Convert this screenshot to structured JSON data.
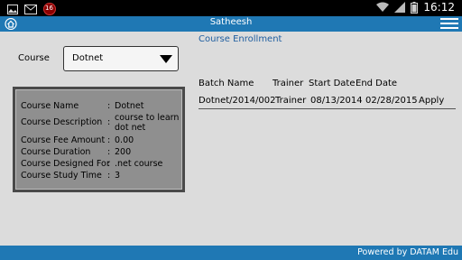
{
  "statusbar": {
    "icons": [
      "image-icon",
      "gmail-icon",
      "notification-count-icon"
    ],
    "badge": "16",
    "right_icons": [
      "wifi-icon",
      "signal-icon",
      "battery-icon"
    ],
    "time": "16:12"
  },
  "appbar": {
    "title": "Satheesh",
    "left_icon": "home-icon",
    "right_icon": "menu-icon"
  },
  "page": {
    "section_title": "Course Enrollment",
    "course_label": "Course",
    "course_selected": "Dotnet"
  },
  "course_info": {
    "rows": [
      {
        "key": "Course Name",
        "sep": ":",
        "value": "Dotnet"
      },
      {
        "key": "Course Description",
        "sep": ":",
        "value": "course to learn dot net"
      },
      {
        "key": "Course Fee Amount",
        "sep": ":",
        "value": "0.00"
      },
      {
        "key": "Course Duration",
        "sep": ":",
        "value": "200"
      },
      {
        "key": "Course Designed For",
        "sep": ":",
        "value": ".net course"
      },
      {
        "key": "Course Study Time",
        "sep": ":",
        "value": "3"
      }
    ]
  },
  "batches": {
    "headers": [
      "Batch Name",
      "Trainer",
      "Start Date",
      "End Date"
    ],
    "rows": [
      {
        "batch": "Dotnet/2014/002",
        "trainer": "Trainer",
        "start": "08/13/2014",
        "end": "02/28/2015",
        "action": "Apply"
      }
    ]
  },
  "footer": {
    "text": "Powered by DATAM Edu"
  },
  "colors": {
    "accent": "#1f78b4",
    "background": "#dcdcdc",
    "info_box": "#8f8f8f"
  }
}
